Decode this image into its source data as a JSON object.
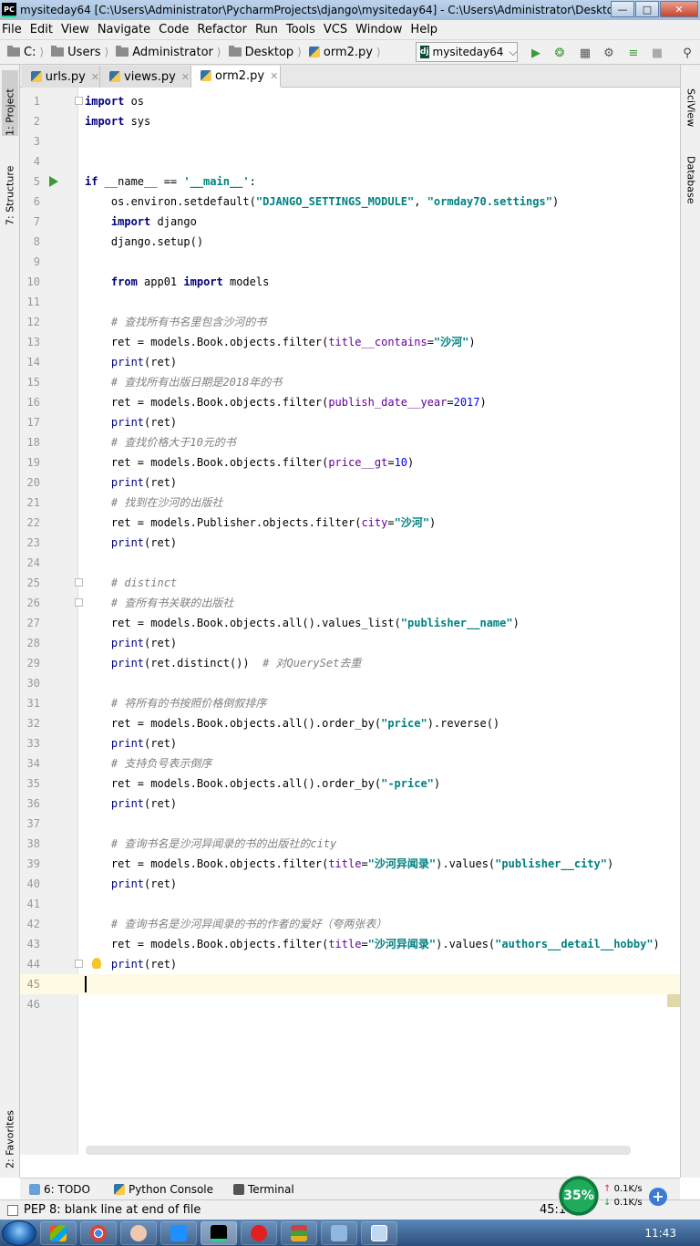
{
  "window": {
    "title": "mysiteday64 [C:\\Users\\Administrator\\PycharmProjects\\django\\mysiteday64] - C:\\Users\\Administrator\\Deskto...",
    "logo": "PC"
  },
  "menu": [
    "File",
    "Edit",
    "View",
    "Navigate",
    "Code",
    "Refactor",
    "Run",
    "Tools",
    "VCS",
    "Window",
    "Help"
  ],
  "breadcrumbs": [
    "C:",
    "Users",
    "Administrator",
    "Desktop",
    "orm2.py"
  ],
  "run_config": {
    "badge": "dj",
    "label": "mysiteday64"
  },
  "left_tabs": [
    {
      "label": "1: Project"
    },
    {
      "label": "7: Structure"
    },
    {
      "label": "2: Favorites"
    }
  ],
  "right_tabs": [
    {
      "label": "SciView"
    },
    {
      "label": "Database"
    }
  ],
  "tabs": [
    {
      "label": "urls.py"
    },
    {
      "label": "views.py"
    },
    {
      "label": "orm2.py"
    }
  ],
  "lines": [
    [
      [
        "import",
        "kw"
      ],
      [
        " os",
        ""
      ]
    ],
    [
      [
        "import",
        "kw"
      ],
      [
        " sys",
        ""
      ]
    ],
    [],
    [],
    [
      [
        "if",
        "kw"
      ],
      [
        " __name__ == ",
        ""
      ],
      [
        "'__main__'",
        "str"
      ],
      [
        ":",
        ""
      ]
    ],
    [
      [
        "    os.environ.setdefault(",
        ""
      ],
      [
        "\"DJANGO_SETTINGS_MODULE\"",
        "str"
      ],
      [
        ", ",
        ""
      ],
      [
        "\"ormday70.settings\"",
        "str"
      ],
      [
        ")",
        ""
      ]
    ],
    [
      [
        "    ",
        ""
      ],
      [
        "import",
        "kw"
      ],
      [
        " django",
        ""
      ]
    ],
    [
      [
        "    django.setup()",
        ""
      ]
    ],
    [],
    [
      [
        "    ",
        ""
      ],
      [
        "from",
        "kw"
      ],
      [
        " app01 ",
        ""
      ],
      [
        "import",
        "kw"
      ],
      [
        " models",
        ""
      ]
    ],
    [],
    [
      [
        "    # 查找所有书名里包含沙河的书",
        "cm"
      ]
    ],
    [
      [
        "    ret = models.Book.objects.filter(",
        ""
      ],
      [
        "title__contains",
        "kwarg"
      ],
      [
        "=",
        ""
      ],
      [
        "\"沙河\"",
        "str"
      ],
      [
        ")",
        ""
      ]
    ],
    [
      [
        "    ",
        ""
      ],
      [
        "print",
        "fn"
      ],
      [
        "(ret)",
        ""
      ]
    ],
    [
      [
        "    # 查找所有出版日期是2018年的书",
        "cm"
      ]
    ],
    [
      [
        "    ret = models.Book.objects.filter(",
        ""
      ],
      [
        "publish_date__year",
        "kwarg"
      ],
      [
        "=",
        ""
      ],
      [
        "2017",
        "num"
      ],
      [
        ")",
        ""
      ]
    ],
    [
      [
        "    ",
        ""
      ],
      [
        "print",
        "fn"
      ],
      [
        "(ret)",
        ""
      ]
    ],
    [
      [
        "    # 查找价格大于10元的书",
        "cm"
      ]
    ],
    [
      [
        "    ret = models.Book.objects.filter(",
        ""
      ],
      [
        "price__gt",
        "kwarg"
      ],
      [
        "=",
        ""
      ],
      [
        "10",
        "num"
      ],
      [
        ")",
        ""
      ]
    ],
    [
      [
        "    ",
        ""
      ],
      [
        "print",
        "fn"
      ],
      [
        "(ret)",
        ""
      ]
    ],
    [
      [
        "    # 找到在沙河的出版社",
        "cm"
      ]
    ],
    [
      [
        "    ret = models.Publisher.objects.filter(",
        ""
      ],
      [
        "city",
        "kwarg"
      ],
      [
        "=",
        ""
      ],
      [
        "\"沙河\"",
        "str"
      ],
      [
        ")",
        ""
      ]
    ],
    [
      [
        "    ",
        ""
      ],
      [
        "print",
        "fn"
      ],
      [
        "(ret)",
        ""
      ]
    ],
    [],
    [
      [
        "    # distinct",
        "cm"
      ]
    ],
    [
      [
        "    # 查所有书关联的出版社",
        "cm"
      ]
    ],
    [
      [
        "    ret = models.Book.objects.all().values_list(",
        ""
      ],
      [
        "\"publisher__name\"",
        "str"
      ],
      [
        ")",
        ""
      ]
    ],
    [
      [
        "    ",
        ""
      ],
      [
        "print",
        "fn"
      ],
      [
        "(ret)",
        ""
      ]
    ],
    [
      [
        "    ",
        ""
      ],
      [
        "print",
        "fn"
      ],
      [
        "(ret.distinct())  ",
        ""
      ],
      [
        "# 对QuerySet去重",
        "cm"
      ]
    ],
    [],
    [
      [
        "    # 将所有的书按照价格倒叙排序",
        "cm"
      ]
    ],
    [
      [
        "    ret = models.Book.objects.all().order_by(",
        ""
      ],
      [
        "\"price\"",
        "str"
      ],
      [
        ").reverse()",
        ""
      ]
    ],
    [
      [
        "    ",
        ""
      ],
      [
        "print",
        "fn"
      ],
      [
        "(ret)",
        ""
      ]
    ],
    [
      [
        "    # 支持负号表示倒序",
        "cm"
      ]
    ],
    [
      [
        "    ret = models.Book.objects.all().order_by(",
        ""
      ],
      [
        "\"-price\"",
        "str"
      ],
      [
        ")",
        ""
      ]
    ],
    [
      [
        "    ",
        ""
      ],
      [
        "print",
        "fn"
      ],
      [
        "(ret)",
        ""
      ]
    ],
    [],
    [
      [
        "    # 查询书名是沙河异闻录的书的出版社的city",
        "cm"
      ]
    ],
    [
      [
        "    ret = models.Book.objects.filter(",
        ""
      ],
      [
        "title",
        "kwarg"
      ],
      [
        "=",
        ""
      ],
      [
        "\"沙河异闻录\"",
        "str"
      ],
      [
        ").values(",
        ""
      ],
      [
        "\"publisher__city\"",
        "str"
      ],
      [
        ")",
        ""
      ]
    ],
    [
      [
        "    ",
        ""
      ],
      [
        "print",
        "fn"
      ],
      [
        "(ret)",
        ""
      ]
    ],
    [],
    [
      [
        "    # 查询书名是沙河异闻录的书的作者的爱好（夸两张表）",
        "cm"
      ]
    ],
    [
      [
        "    ret = models.Book.objects.filter(",
        ""
      ],
      [
        "title",
        "kwarg"
      ],
      [
        "=",
        ""
      ],
      [
        "\"沙河异闻录\"",
        "str"
      ],
      [
        ").values(",
        ""
      ],
      [
        "\"authors__detail__hobby\"",
        "str"
      ],
      [
        ")",
        ""
      ]
    ],
    [
      [
        "    ",
        ""
      ],
      [
        "print",
        "fn"
      ],
      [
        "(ret)",
        ""
      ]
    ],
    [],
    []
  ],
  "current_line": 45,
  "bottom_tabs": [
    {
      "label": "6: TODO"
    },
    {
      "label": "Python Console"
    },
    {
      "label": "Terminal"
    }
  ],
  "status": {
    "message": "PEP 8: blank line at end of file",
    "caret": "45:1"
  },
  "network_widget": {
    "cpu": "35%",
    "up": "0.1K/s",
    "down": "0.1K/s"
  },
  "taskbar": {
    "clock": "11:43"
  },
  "colors": {
    "keyword": "#000080",
    "string": "#008080",
    "comment": "#808080",
    "number": "#0000ff",
    "kwarg": "#660099",
    "current_line": "#fffae3"
  }
}
